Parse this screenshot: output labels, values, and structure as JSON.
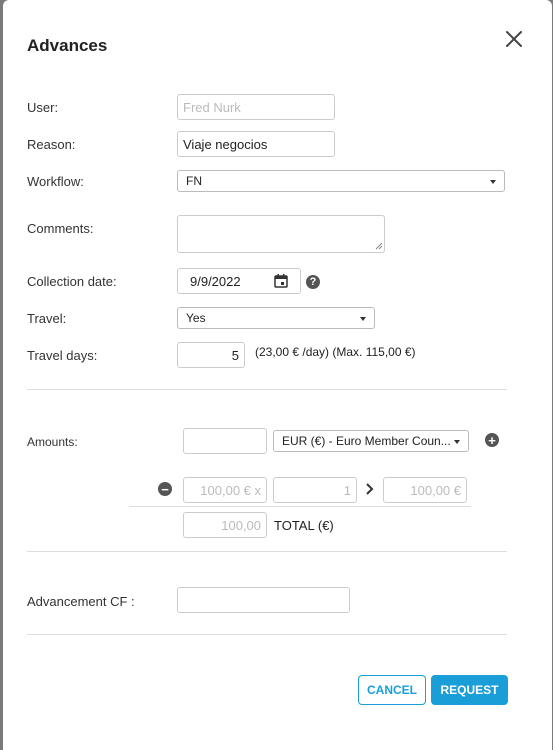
{
  "modal": {
    "title": "Advances"
  },
  "user": {
    "label": "User:",
    "value": "Fred Nurk"
  },
  "reason": {
    "label": "Reason:",
    "value": "Viaje negocios"
  },
  "workflow": {
    "label": "Workflow:",
    "value": "FN"
  },
  "comments": {
    "label": "Comments:",
    "value": ""
  },
  "collection_date": {
    "label": "Collection date:",
    "value": "9/9/2022"
  },
  "travel": {
    "label": "Travel:",
    "value": "Yes"
  },
  "travel_days": {
    "label": "Travel days:",
    "value": "5",
    "note": "(23,00 € /day) (Max. 115,00 €)"
  },
  "amounts": {
    "label": "Amounts:",
    "value": "",
    "currency": "EUR (€) - Euro Member Coun...",
    "rate_placeholder": "100,00 € x",
    "qty_placeholder": "1",
    "result_placeholder": "100,00 €",
    "total_value": "100,00",
    "total_label": "TOTAL (€)"
  },
  "advancement_cf": {
    "label": "Advancement CF :",
    "value": ""
  },
  "buttons": {
    "cancel": "CANCEL",
    "request": "REQUEST"
  },
  "icons": {
    "close": "close-icon",
    "calendar": "calendar-icon",
    "help": "question-icon",
    "add": "plus-circle-icon",
    "remove": "minus-circle-icon",
    "arrow": "chevron-right-icon"
  },
  "colors": {
    "primary": "#1a9ed8",
    "icon_dark": "#555555"
  }
}
